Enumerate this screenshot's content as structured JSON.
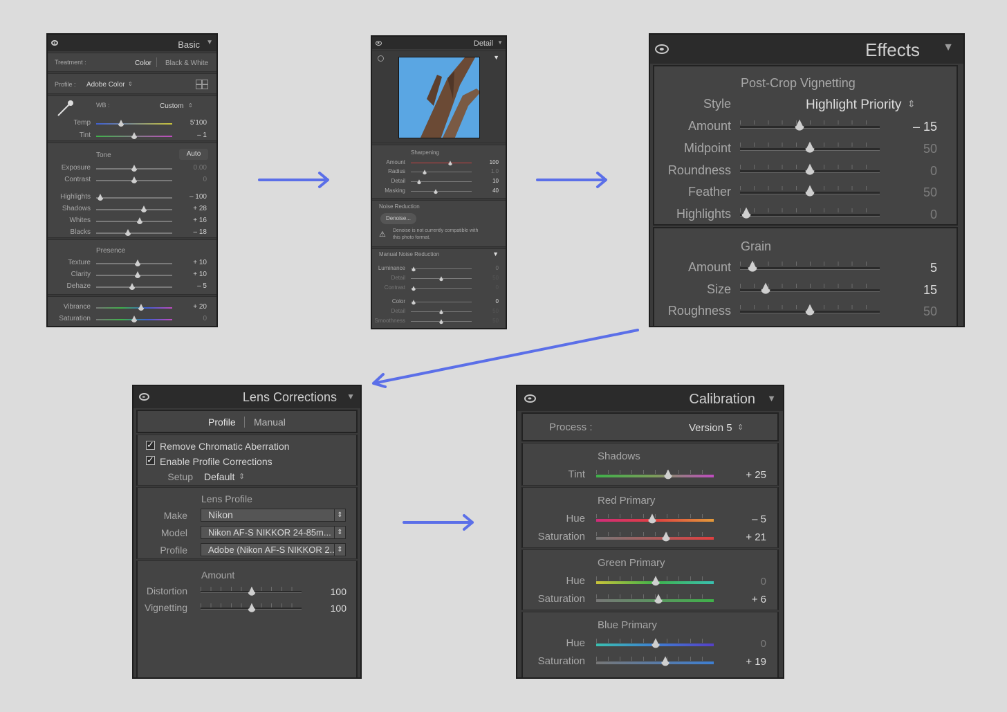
{
  "basic": {
    "title": "Basic",
    "treatment_label": "Treatment :",
    "treatment_color": "Color",
    "treatment_bw": "Black & White",
    "profile_label": "Profile :",
    "profile_value": "Adobe Color",
    "wb_label": "WB :",
    "wb_value": "Custom",
    "temp_label": "Temp",
    "temp_value": "5'100",
    "tint_label": "Tint",
    "tint_value": "– 1",
    "tone_label": "Tone",
    "auto_label": "Auto",
    "exposure_label": "Exposure",
    "exposure_value": "0.00",
    "contrast_label": "Contrast",
    "contrast_value": "0",
    "highlights_label": "Highlights",
    "highlights_value": "– 100",
    "shadows_label": "Shadows",
    "shadows_value": "+ 28",
    "whites_label": "Whites",
    "whites_value": "+ 16",
    "blacks_label": "Blacks",
    "blacks_value": "– 18",
    "presence_label": "Presence",
    "texture_label": "Texture",
    "texture_value": "+ 10",
    "clarity_label": "Clarity",
    "clarity_value": "+ 10",
    "dehaze_label": "Dehaze",
    "dehaze_value": "– 5",
    "vibrance_label": "Vibrance",
    "vibrance_value": "+ 20",
    "saturation_label": "Saturation",
    "saturation_value": "0"
  },
  "detail": {
    "title": "Detail",
    "sharpening_label": "Sharpening",
    "amount_label": "Amount",
    "amount_value": "100",
    "radius_label": "Radius",
    "radius_value": "1.0",
    "detail_label": "Detail",
    "detail_value": "10",
    "masking_label": "Masking",
    "masking_value": "40",
    "noise_label": "Noise Reduction",
    "denoise_button": "Denoise...",
    "warning_line1": "Denoise is not currently compatible with",
    "warning_line2": "this photo format.",
    "manual_label": "Manual Noise Reduction",
    "luminance_label": "Luminance",
    "luminance_value": "0",
    "lum_detail_label": "Detail",
    "lum_detail_value": "50",
    "lum_contrast_label": "Contrast",
    "lum_contrast_value": "0",
    "color_label": "Color",
    "color_value": "0",
    "col_detail_label": "Detail",
    "col_detail_value": "50",
    "smoothness_label": "Smoothness",
    "smoothness_value": "50"
  },
  "effects": {
    "title": "Effects",
    "vignette_label": "Post-Crop Vignetting",
    "style_label": "Style",
    "style_value": "Highlight Priority",
    "amount_label": "Amount",
    "amount_value": "– 15",
    "midpoint_label": "Midpoint",
    "midpoint_value": "50",
    "roundness_label": "Roundness",
    "roundness_value": "0",
    "feather_label": "Feather",
    "feather_value": "50",
    "highlights_label": "Highlights",
    "highlights_value": "0",
    "grain_label": "Grain",
    "g_amount_label": "Amount",
    "g_amount_value": "5",
    "g_size_label": "Size",
    "g_size_value": "15",
    "g_rough_label": "Roughness",
    "g_rough_value": "50"
  },
  "lens": {
    "title": "Lens Corrections",
    "tab_profile": "Profile",
    "tab_manual": "Manual",
    "chk_aberration": "Remove Chromatic Aberration",
    "chk_profile": "Enable Profile Corrections",
    "setup_label": "Setup",
    "setup_value": "Default",
    "lens_profile_label": "Lens Profile",
    "make_label": "Make",
    "make_value": "Nikon",
    "model_label": "Model",
    "model_value": "Nikon AF-S NIKKOR 24-85m...",
    "profile_label": "Profile",
    "profile_value": "Adobe (Nikon AF-S NIKKOR 2...",
    "amount_label": "Amount",
    "distortion_label": "Distortion",
    "distortion_value": "100",
    "vignetting_label": "Vignetting",
    "vignetting_value": "100"
  },
  "calibration": {
    "title": "Calibration",
    "process_label": "Process :",
    "process_value": "Version 5",
    "shadows_label": "Shadows",
    "tint_label": "Tint",
    "tint_value": "+ 25",
    "red_label": "Red Primary",
    "red_hue_label": "Hue",
    "red_hue_value": "– 5",
    "red_sat_label": "Saturation",
    "red_sat_value": "+ 21",
    "green_label": "Green Primary",
    "green_hue_label": "Hue",
    "green_hue_value": "0",
    "green_sat_label": "Saturation",
    "green_sat_value": "+ 6",
    "blue_label": "Blue Primary",
    "blue_hue_label": "Hue",
    "blue_hue_value": "0",
    "blue_sat_label": "Saturation",
    "blue_sat_value": "+ 19"
  },
  "colors": {
    "arrow": "#5b6fe8",
    "panel_bg": "#3a3a3a",
    "section_bg": "#444444"
  }
}
